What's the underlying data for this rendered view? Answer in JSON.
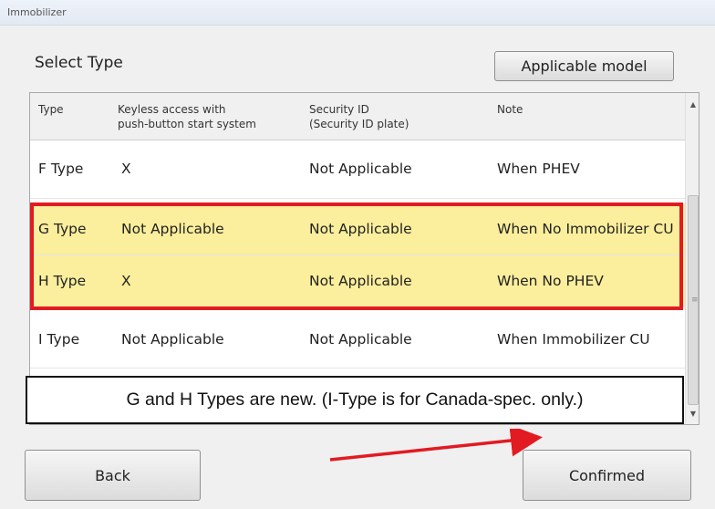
{
  "window": {
    "title": "Immobilizer"
  },
  "section_title": "Select Type",
  "buttons": {
    "applicable_model": "Applicable model",
    "back": "Back",
    "confirmed": "Confirmed"
  },
  "table": {
    "headers": {
      "type": "Type",
      "keyless_line1": "Keyless access with",
      "keyless_line2": "push-button start system",
      "security_line1": "Security ID",
      "security_line2": "(Security ID plate)",
      "note": "Note"
    },
    "rows": [
      {
        "type": "F Type",
        "keyless": "X",
        "security_id": "Not Applicable",
        "note": "When PHEV",
        "highlighted": false
      },
      {
        "type": "G Type",
        "keyless": "Not Applicable",
        "security_id": "Not Applicable",
        "note": "When No Immobilizer  CU",
        "highlighted": true
      },
      {
        "type": "H Type",
        "keyless": "X",
        "security_id": "Not Applicable",
        "note": "When No PHEV",
        "highlighted": true
      },
      {
        "type": "I Type",
        "keyless": "Not Applicable",
        "security_id": "Not Applicable",
        "note": "When Immobilizer CU",
        "highlighted": false
      }
    ]
  },
  "annotation": {
    "text": "G and H Types are new.  (I-Type is for Canada-spec. only.)",
    "box_color": "#111111",
    "highlight_color": "#fbee9c",
    "red_outline_color": "#e21a22"
  }
}
